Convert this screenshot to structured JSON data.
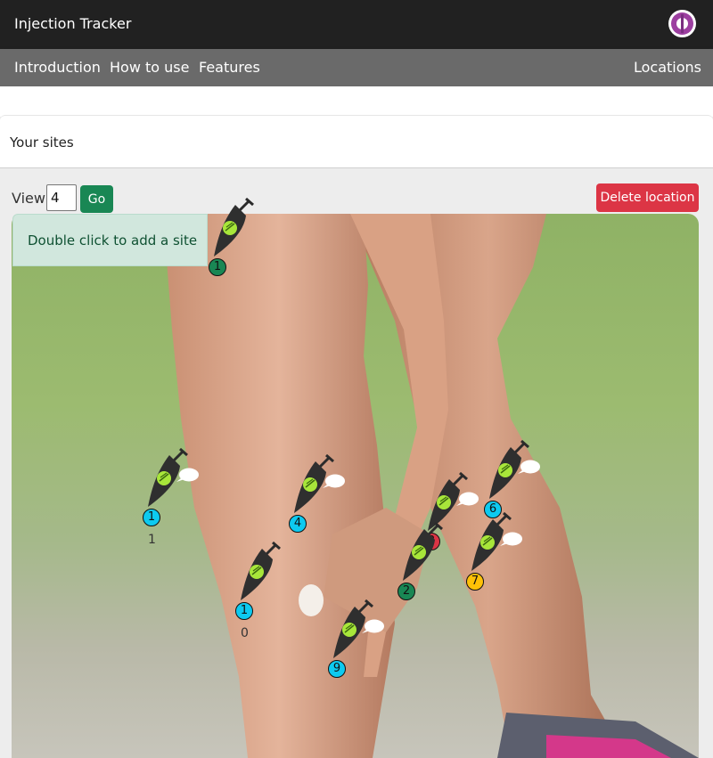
{
  "app": {
    "title": "Injection Tracker"
  },
  "nav": {
    "introduction": "Introduction",
    "how_to_use": "How to use",
    "features": "Features",
    "locations": "Locations"
  },
  "sites": {
    "title": "Your sites"
  },
  "controls": {
    "view_label": "View",
    "view_value": "4",
    "go_label": "Go",
    "delete_label": "Delete location"
  },
  "hint": {
    "text": "Double click to add a site"
  },
  "markers": [
    {
      "number": "1",
      "color": "#198754",
      "comment": false,
      "count": ""
    },
    {
      "number": "1",
      "color": "#0dcaf0",
      "comment": true,
      "count": "1"
    },
    {
      "number": "4",
      "color": "#0dcaf0",
      "comment": true,
      "count": ""
    },
    {
      "number": "1",
      "color": "#0dcaf0",
      "comment": false,
      "count": "0"
    },
    {
      "number": "9",
      "color": "#0dcaf0",
      "comment": true,
      "count": ""
    },
    {
      "number": "3",
      "color": "#dc3545",
      "comment": true,
      "count": ""
    },
    {
      "number": "2",
      "color": "#198754",
      "comment": false,
      "count": ""
    },
    {
      "number": "6",
      "color": "#0dcaf0",
      "comment": true,
      "count": ""
    },
    {
      "number": "7",
      "color": "#ffc107",
      "comment": true,
      "count": ""
    }
  ]
}
